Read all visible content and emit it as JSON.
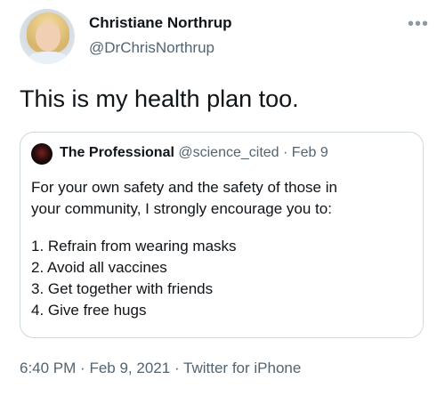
{
  "author": {
    "name": "Christiane Northrup",
    "handle": "@DrChrisNorthrup",
    "more_icon": "more-icon",
    "more_glyph": "•••"
  },
  "tweet": {
    "text": "This is my health plan too."
  },
  "quoted_tweet": {
    "name": "The Professional",
    "handle": "@science_cited",
    "separator": "·",
    "date": "Feb 9",
    "lines": [
      "For your own safety and the safety of those in",
      "your community, I strongly encourage you to:"
    ],
    "list": [
      "1. Refrain from wearing masks",
      "2. Avoid all vaccines",
      "3. Get together with friends",
      "4. Give free hugs"
    ]
  },
  "footer": {
    "time": "6:40 PM",
    "separator1": "·",
    "date": "Feb 9, 2021",
    "separator2": "·",
    "source": "Twitter for iPhone"
  }
}
